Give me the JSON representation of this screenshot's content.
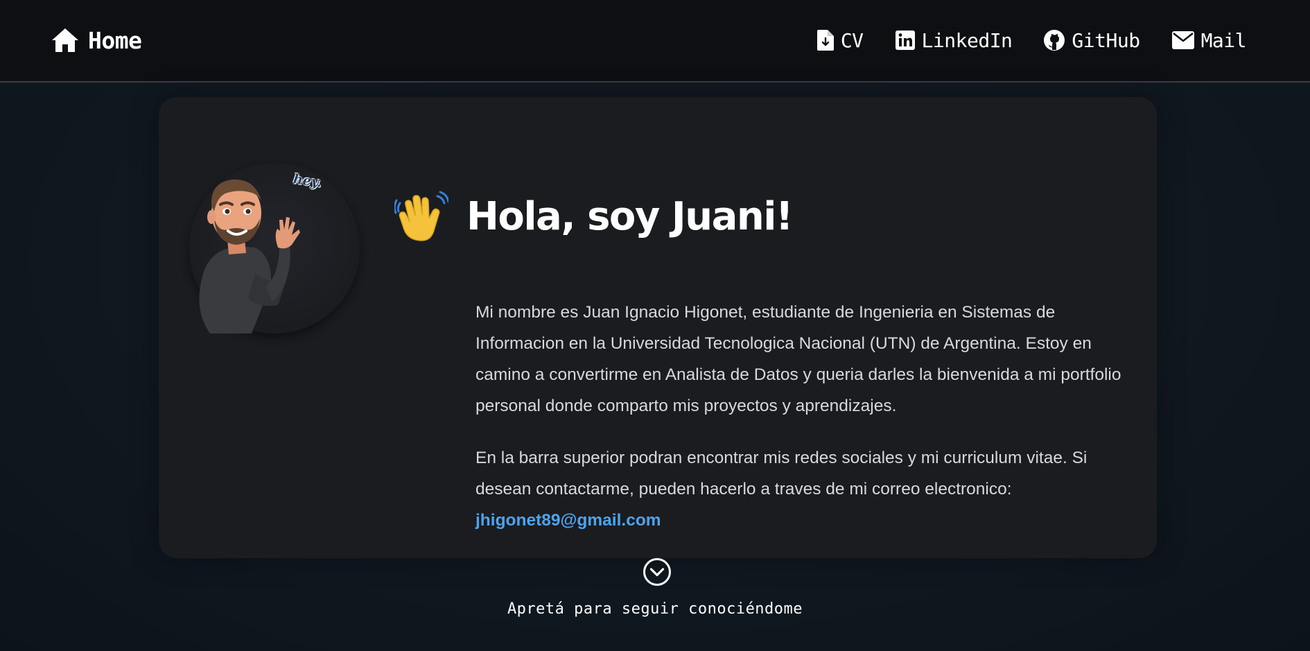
{
  "nav": {
    "home": {
      "label": "Home",
      "icon": "home-icon"
    },
    "links": [
      {
        "label": "CV",
        "icon": "file-download-icon"
      },
      {
        "label": "LinkedIn",
        "icon": "linkedin-icon"
      },
      {
        "label": "GitHub",
        "icon": "github-icon"
      },
      {
        "label": "Mail",
        "icon": "envelope-icon"
      }
    ]
  },
  "hero": {
    "sticker": "hey.",
    "title": "Hola, soy Juani!",
    "bio_paragraph_1": "Mi nombre es Juan Ignacio Higonet, estudiante de Ingenieria en Sistemas de Informacion en la Universidad Tecnologica Nacional (UTN) de Argentina. Estoy en camino a convertirme en Analista de Datos y queria darles la bienvenida a mi portfolio personal donde comparto mis proyectos y aprendizajes.",
    "bio_paragraph_2": "En la barra superior podran encontrar mis redes sociales y mi curriculum vitae. Si desean contactarme, pueden hacerlo a traves de mi correo electronico:",
    "email": "jhigonet89@gmail.com"
  },
  "scroll_cta": {
    "text": "Apretá para seguir conociéndome",
    "icon": "chevron-down-circle-icon"
  },
  "colors": {
    "background": "#0f141a",
    "navbar": "#0d0f13",
    "card": "#1b1c20",
    "link": "#4ea3ee",
    "text": "#d9d9dc"
  }
}
